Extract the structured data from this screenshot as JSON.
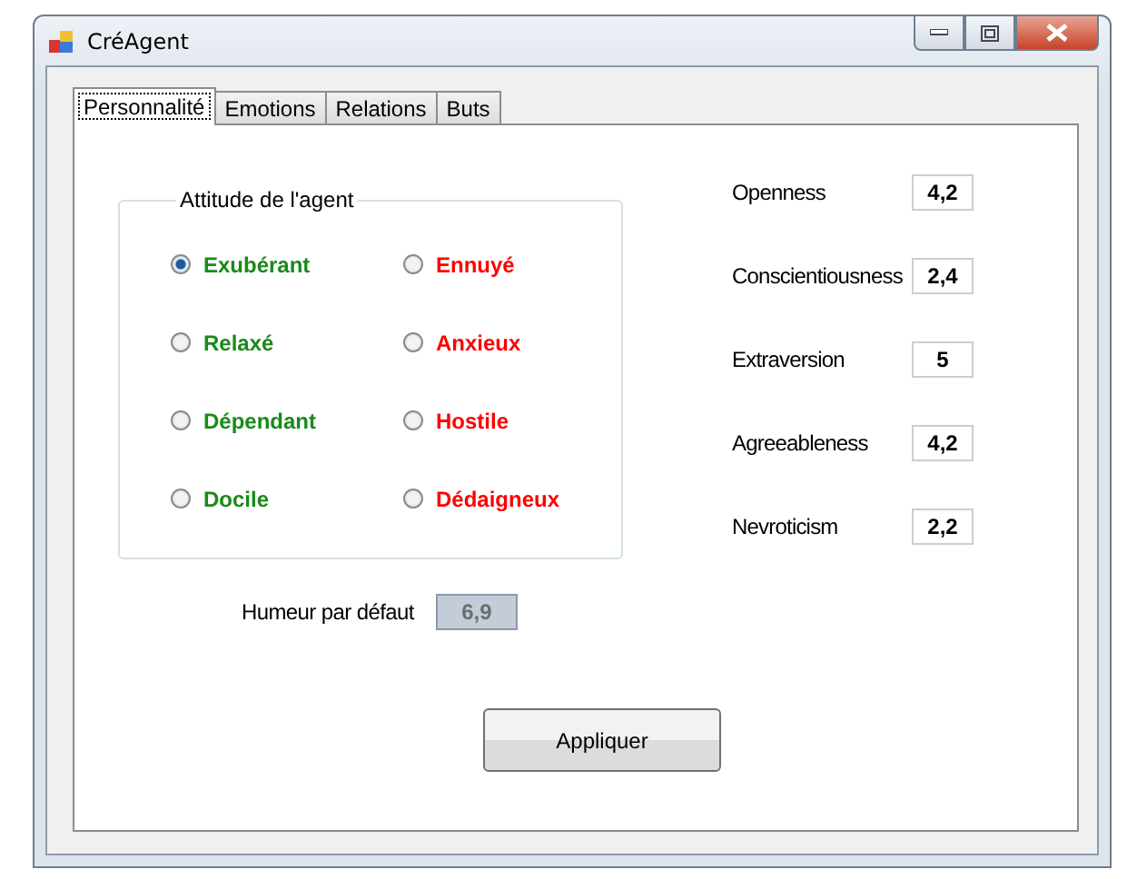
{
  "window": {
    "title": "CréAgent"
  },
  "tabs": [
    {
      "label": "Personnalité",
      "selected": true
    },
    {
      "label": "Emotions",
      "selected": false
    },
    {
      "label": "Relations",
      "selected": false
    },
    {
      "label": "Buts",
      "selected": false
    }
  ],
  "attitude_group": {
    "title": "Attitude de l'agent",
    "options": [
      {
        "label": "Exubérant",
        "selected": true,
        "color": "#1a8a1a"
      },
      {
        "label": "Ennuyé",
        "selected": false,
        "color": "#ff0000"
      },
      {
        "label": "Relaxé",
        "selected": false,
        "color": "#1a8a1a"
      },
      {
        "label": "Anxieux",
        "selected": false,
        "color": "#ff0000"
      },
      {
        "label": "Dépendant",
        "selected": false,
        "color": "#1a8a1a"
      },
      {
        "label": "Hostile",
        "selected": false,
        "color": "#ff0000"
      },
      {
        "label": "Docile",
        "selected": false,
        "color": "#1a8a1a"
      },
      {
        "label": "Dédaigneux",
        "selected": false,
        "color": "#ff0000"
      }
    ]
  },
  "traits": [
    {
      "label": "Openness",
      "value": "4,2"
    },
    {
      "label": "Conscientiousness",
      "value": "2,4"
    },
    {
      "label": "Extraversion",
      "value": "5"
    },
    {
      "label": "Agreeableness",
      "value": "4,2"
    },
    {
      "label": "Nevroticism",
      "value": "2,2"
    }
  ],
  "default_mood": {
    "label": "Humeur par défaut",
    "value": "6,9",
    "disabled": true
  },
  "apply_button": "Appliquer"
}
